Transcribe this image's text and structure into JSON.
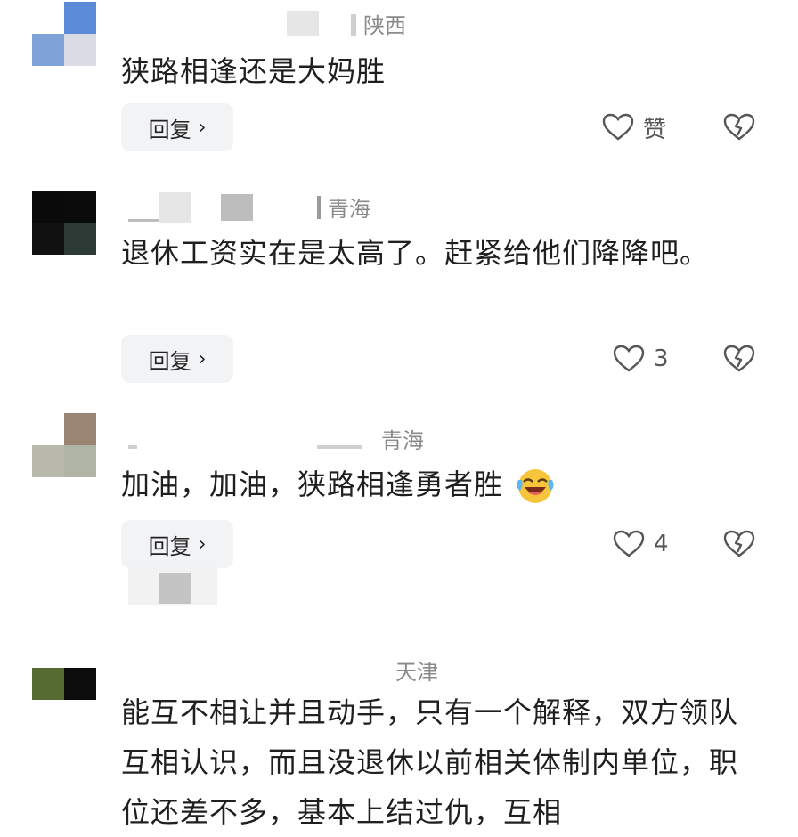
{
  "comments": [
    {
      "region": "陕西",
      "text": "狭路相逢还是大妈胜",
      "reply_label": "回复",
      "like_label": "赞",
      "avatar_colors": [
        "#ffffff",
        "#5b8bd6",
        "#7fa2d9",
        "#d9dce3"
      ]
    },
    {
      "region": "青海",
      "text": "退休工资实在是太高了。赶紧给他们降降吧。",
      "reply_label": "回复",
      "like_label": "3",
      "avatar_colors": [
        "#0a0a0a",
        "#0b0b0b",
        "#111111",
        "#2d3a36"
      ]
    },
    {
      "region": "青海",
      "text": "加油，加油，狭路相逢勇者胜",
      "reply_label": "回复",
      "like_label": "4",
      "avatar_colors": [
        "#ffffff",
        "#9a8474",
        "#b8b8ac",
        "#b0b4a6"
      ]
    },
    {
      "region": "天津",
      "text": "能互不相让并且动手，只有一个解释，双方领队互相认识，而且没退休以前相关体制内单位，职位还差不多，基本上结过仇，互相",
      "avatar_colors": [
        "#556b32",
        "#0c0c0c"
      ]
    }
  ],
  "icons": {
    "reply_chevron": "chevron-right-icon",
    "like": "heart-icon",
    "dislike": "broken-heart-icon",
    "emoji": "laughing-crying-emoji"
  }
}
